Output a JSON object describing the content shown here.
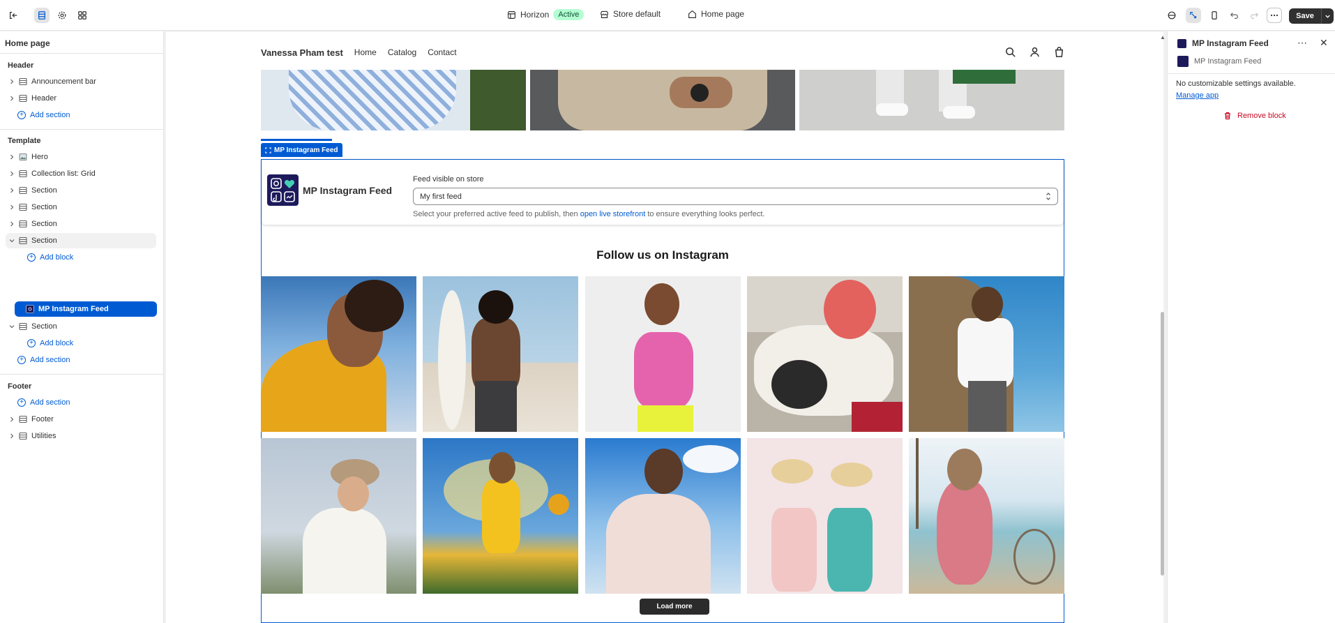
{
  "topbar": {
    "theme_name": "Horizon",
    "theme_status": "Active",
    "store": "Store default",
    "page": "Home page",
    "save_label": "Save"
  },
  "sidebar": {
    "title": "Home page",
    "header_group": "Header",
    "header_items": [
      {
        "label": "Announcement bar",
        "icon": "layout-icon"
      },
      {
        "label": "Header",
        "icon": "layout-icon"
      },
      {
        "label": "Add section",
        "icon": "plus-circle-icon"
      }
    ],
    "template_group": "Template",
    "template_items": [
      {
        "label": "Hero",
        "icon": "image-icon"
      },
      {
        "label": "Collection list: Grid",
        "icon": "layout-icon"
      },
      {
        "label": "Section",
        "icon": "layout-icon"
      },
      {
        "label": "Section",
        "icon": "layout-icon"
      },
      {
        "label": "Section",
        "icon": "layout-icon"
      },
      {
        "label": "Section",
        "icon": "layout-icon"
      },
      {
        "label": "Add block",
        "icon": "plus-circle-icon"
      },
      {
        "label": "MP Instagram Feed",
        "icon": "app-icon"
      },
      {
        "label": "Section",
        "icon": "layout-icon"
      },
      {
        "label": "Add block",
        "icon": "plus-circle-icon"
      },
      {
        "label": "Add section",
        "icon": "plus-circle-icon"
      }
    ],
    "footer_group": "Footer",
    "footer_items": [
      {
        "label": "Add section",
        "icon": "plus-circle-icon"
      },
      {
        "label": "Footer",
        "icon": "layout-icon"
      },
      {
        "label": "Utilities",
        "icon": "layout-icon"
      }
    ]
  },
  "preview": {
    "store_name": "Vanessa Pham test",
    "nav": [
      "Home",
      "Catalog",
      "Contact"
    ],
    "section_tag": "MP Instagram Feed",
    "app_card": {
      "name": "MP Instagram Feed",
      "feed_label": "Feed visible on store",
      "feed_value": "My first feed",
      "help_before": "Select your preferred active feed to publish, then ",
      "help_link": "open live storefront",
      "help_after": " to ensure everything looks perfect."
    },
    "follow_title": "Follow us on Instagram",
    "load_more": "Load more"
  },
  "right_panel": {
    "title": "MP Instagram Feed",
    "subtitle": "MP Instagram Feed",
    "no_settings": "No customizable settings available.",
    "manage_link": "Manage app",
    "remove_label": "Remove block"
  },
  "colors": {
    "accent": "#005bd3",
    "danger": "#c70a24",
    "active_badge": "#b4fed2",
    "save_button": "#303030"
  }
}
